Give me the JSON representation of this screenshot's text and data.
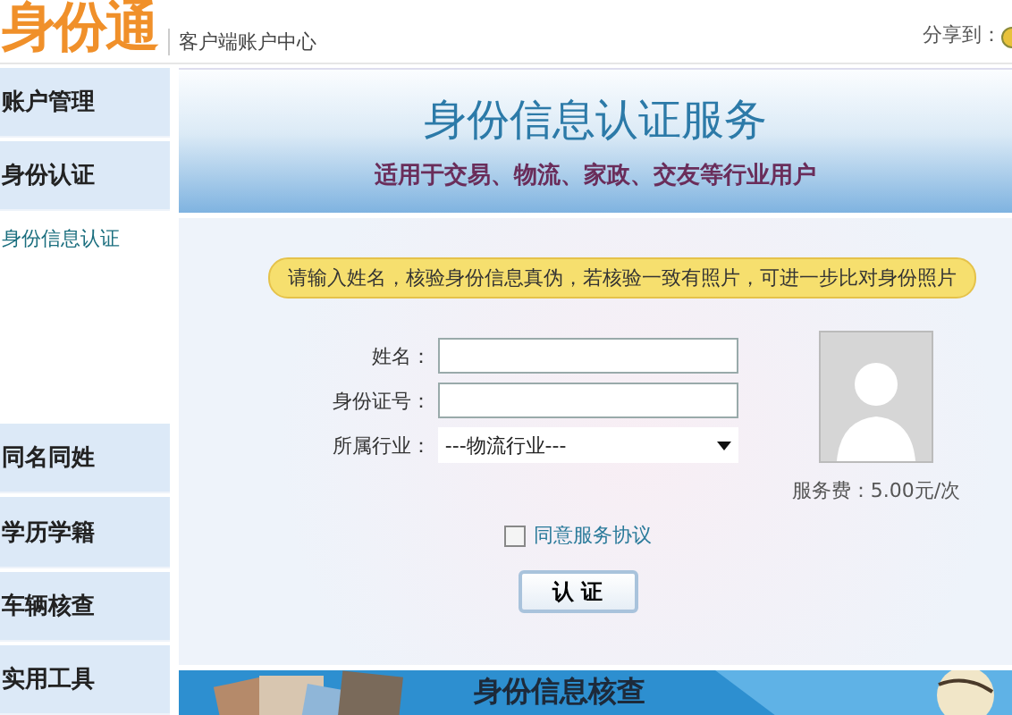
{
  "header": {
    "logo": "身份通",
    "subtitle": "客户端账户中心",
    "share_label": "分享到："
  },
  "sidebar": {
    "items": [
      {
        "label": "账户管理"
      },
      {
        "label": "身份认证",
        "children": [
          {
            "label": "身份信息认证"
          }
        ]
      },
      {
        "label": "同名同姓"
      },
      {
        "label": "学历学籍"
      },
      {
        "label": "车辆核查"
      },
      {
        "label": "实用工具"
      }
    ]
  },
  "banner": {
    "title": "身份信息认证服务",
    "subtitle": "适用于交易、物流、家政、交友等行业用户"
  },
  "notice": "请输入姓名，核验身份信息真伪，若核验一致有照片，可进一步比对身份照片",
  "form": {
    "fields": [
      {
        "label": "姓名：",
        "kind": "text"
      },
      {
        "label": "身份证号：",
        "kind": "text"
      },
      {
        "label": "所属行业：",
        "kind": "select",
        "value": "---物流行业---"
      }
    ],
    "fee": "服务费：5.00元/次",
    "agreement": {
      "label": "同意服务协议",
      "checked": false
    },
    "submit": "认 证"
  },
  "promo": {
    "title": "身份信息核查"
  }
}
